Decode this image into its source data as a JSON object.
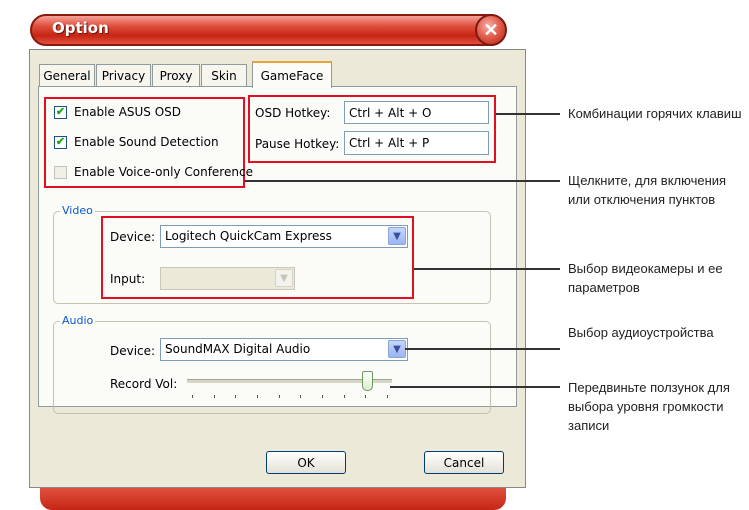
{
  "window": {
    "title": "Option",
    "close_glyph": "✕"
  },
  "tabs": [
    {
      "label": "General",
      "active": false
    },
    {
      "label": "Privacy",
      "active": false
    },
    {
      "label": "Proxy",
      "active": false
    },
    {
      "label": "Skin",
      "active": false
    },
    {
      "label": "GameFace",
      "active": true
    }
  ],
  "options": {
    "enable_asus_osd": {
      "label": "Enable ASUS OSD",
      "checked": true
    },
    "enable_sound_detection": {
      "label": "Enable Sound Detection",
      "checked": true
    },
    "enable_voice_only": {
      "label": "Enable Voice-only Conference",
      "checked": false
    }
  },
  "hotkeys": {
    "osd": {
      "label": "OSD Hotkey:",
      "value": "Ctrl + Alt + O"
    },
    "pause": {
      "label": "Pause Hotkey:",
      "value": "Ctrl + Alt + P"
    }
  },
  "video": {
    "group_label": "Video",
    "device_label": "Device:",
    "device_value": "Logitech QuickCam Express",
    "input_label": "Input:",
    "input_value": ""
  },
  "audio": {
    "group_label": "Audio",
    "device_label": "Device:",
    "device_value": "SoundMAX Digital Audio",
    "record_vol_label": "Record Vol:",
    "record_vol_level": 0.9
  },
  "buttons": {
    "ok": "OK",
    "cancel": "Cancel"
  },
  "callouts": {
    "hotkeys": "Комбинации горячих клавиш",
    "toggle": "Щелкните, для включения или отключения пунктов",
    "camera": "Выбор видеокамеры и ее параметров",
    "audio": "Выбор аудиоустройства",
    "slider": "Передвиньте ползунок для выбора уровня громкости записи"
  },
  "colors": {
    "highlight_red": "#e10f1f",
    "titlebar_red": "#c62514",
    "group_label_blue": "#0b57d0"
  },
  "icons": {
    "check": "checkmark-icon",
    "dropdown": "chevron-down-icon",
    "close": "close-icon"
  }
}
